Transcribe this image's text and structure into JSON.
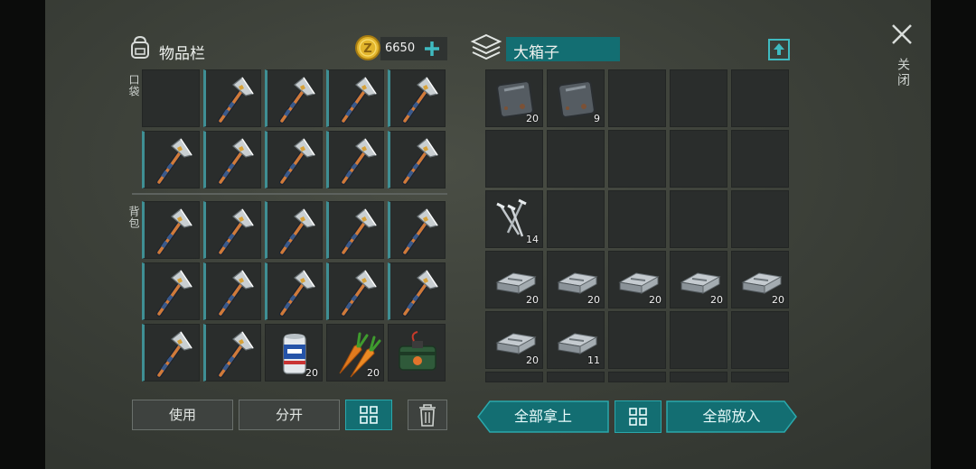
{
  "inventory": {
    "title": "物品栏",
    "coins": "6650",
    "pocket_label": "口袋",
    "backpack_label": "背包",
    "slots": [
      {
        "item": "empty"
      },
      {
        "item": "hatchet"
      },
      {
        "item": "hatchet"
      },
      {
        "item": "hatchet"
      },
      {
        "item": "hatchet"
      },
      {
        "item": "hatchet"
      },
      {
        "item": "hatchet"
      },
      {
        "item": "hatchet"
      },
      {
        "item": "hatchet"
      },
      {
        "item": "hatchet"
      },
      {
        "item": "hatchet"
      },
      {
        "item": "hatchet"
      },
      {
        "item": "hatchet"
      },
      {
        "item": "hatchet"
      },
      {
        "item": "hatchet"
      },
      {
        "item": "hatchet"
      },
      {
        "item": "hatchet"
      },
      {
        "item": "hatchet"
      },
      {
        "item": "hatchet"
      },
      {
        "item": "hatchet"
      },
      {
        "item": "hatchet"
      },
      {
        "item": "hatchet"
      },
      {
        "item": "soda-can",
        "count": "20"
      },
      {
        "item": "carrot",
        "count": "20"
      },
      {
        "item": "explosive"
      }
    ],
    "use_label": "使用",
    "split_label": "分开"
  },
  "chest": {
    "title": "大箱子",
    "slots": [
      {
        "item": "metal-plate",
        "count": "20"
      },
      {
        "item": "metal-plate",
        "count": "9"
      },
      {
        "item": "empty"
      },
      {
        "item": "empty"
      },
      {
        "item": "empty"
      },
      {
        "item": "empty"
      },
      {
        "item": "empty"
      },
      {
        "item": "empty"
      },
      {
        "item": "empty"
      },
      {
        "item": "empty"
      },
      {
        "item": "nails",
        "count": "14"
      },
      {
        "item": "empty"
      },
      {
        "item": "empty"
      },
      {
        "item": "empty"
      },
      {
        "item": "empty"
      },
      {
        "item": "iron-ingot",
        "count": "20"
      },
      {
        "item": "iron-ingot",
        "count": "20"
      },
      {
        "item": "iron-ingot",
        "count": "20"
      },
      {
        "item": "iron-ingot",
        "count": "20"
      },
      {
        "item": "iron-ingot",
        "count": "20"
      },
      {
        "item": "iron-ingot",
        "count": "20"
      },
      {
        "item": "iron-ingot",
        "count": "11"
      },
      {
        "item": "empty"
      },
      {
        "item": "empty"
      },
      {
        "item": "empty"
      }
    ],
    "take_all_label": "全部拿上",
    "put_all_label": "全部放入"
  },
  "close_label": "关闭",
  "colors": {
    "accent": "#136e72",
    "accent_border": "#2aa8ac",
    "slot": "#2a2d2c",
    "gold": "#e2b52c"
  }
}
